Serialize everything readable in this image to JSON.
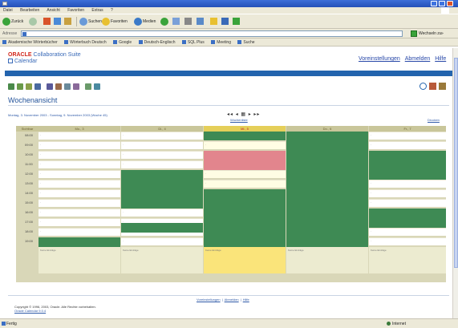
{
  "window": {
    "title": "",
    "menu": [
      "Datei",
      "Bearbeiten",
      "Ansicht",
      "Favoriten",
      "Extras",
      "?"
    ]
  },
  "toolbar": {
    "back": "Zurück",
    "search": "Suchen",
    "favorites": "Favoriten",
    "media": "Medien"
  },
  "address": {
    "label": "Adresse",
    "url": "",
    "go": "Wechseln zu",
    "links": "»"
  },
  "linksbar": {
    "items": [
      "Akademische Wörterbücher",
      "Wörterbuch Deutsch",
      "Google",
      "Deutsch-Englisch",
      "SQL Plus",
      "Meeting",
      "Suche"
    ]
  },
  "header": {
    "brand": "ORACLE",
    "suite": "Collaboration Suite",
    "app": "Calendar",
    "links": [
      "Voreinstellungen",
      "Abmelden",
      "Hilfe"
    ]
  },
  "page": {
    "title": "Wochenansicht",
    "owner": "",
    "date_range": "Montag, 3. November 2003 - Sonntag, 9. November 2003 (Woche 45)",
    "nav_arrows": "◂◂ ◂ ▦ ▸ ▸▸",
    "view_link": "Wochenliste",
    "print_link": "Drucken"
  },
  "calendar": {
    "corner_label": "Sichtbar",
    "days": [
      {
        "label": "Mo., 3"
      },
      {
        "label": "Di., 4"
      },
      {
        "label": "Mi., 5"
      },
      {
        "label": "Do., 6"
      },
      {
        "label": "Fr., 7"
      }
    ],
    "times": [
      "08:00",
      "09:00",
      "10:00",
      "11:00",
      "12:00",
      "13:00",
      "14:00",
      "15:00",
      "16:00",
      "17:00",
      "18:00",
      "19:00"
    ],
    "slot_placeholder": "-",
    "bottom_label": "Keine Einträge",
    "events": [
      {
        "title": "",
        "time": ""
      },
      {
        "title": "",
        "time": ""
      },
      {
        "title": "",
        "time": ""
      },
      {
        "title": "",
        "time": ""
      },
      {
        "title": "",
        "time": ""
      },
      {
        "title": "",
        "time": ""
      },
      {
        "title": "",
        "time": ""
      },
      {
        "title": "",
        "time": ""
      },
      {
        "title": "",
        "time": ""
      },
      {
        "title": "",
        "time": ""
      }
    ]
  },
  "footer": {
    "links": [
      "Voreinstellungen",
      "Abmelden",
      "Hilfe"
    ],
    "copyright": "Copyright © 1996, 2003, Oracle. Alle Rechte vorbehalten.",
    "version": "Oracle Calendar 9.0.4"
  },
  "status": {
    "text": "Fertig",
    "zone": "Internet"
  },
  "colors": {
    "titlebar": "#2450b8",
    "bluebar": "#2364ae",
    "event": "#3e8a54",
    "event_alt": "#e2858d",
    "today_header": "#e5cf59"
  }
}
